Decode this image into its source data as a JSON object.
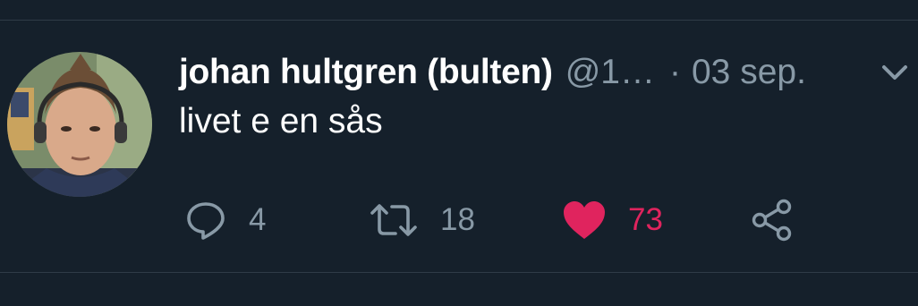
{
  "tweet": {
    "author_name": "johan hultgren (bulten)",
    "handle": "@1…",
    "separator": "·",
    "timestamp": "03 sep.",
    "text": "livet e en sås",
    "actions": {
      "reply": {
        "icon": "reply-icon",
        "count": "4"
      },
      "retweet": {
        "icon": "retweet-icon",
        "count": "18"
      },
      "like": {
        "icon": "heart-icon",
        "count": "73",
        "liked": true
      },
      "share": {
        "icon": "share-icon"
      }
    },
    "menu_icon": "chevron-down-icon"
  },
  "colors": {
    "background": "#15202b",
    "primary_text": "#ffffff",
    "secondary_text": "#8899a6",
    "like_active": "#e0245e",
    "divider": "#2f3b47"
  }
}
